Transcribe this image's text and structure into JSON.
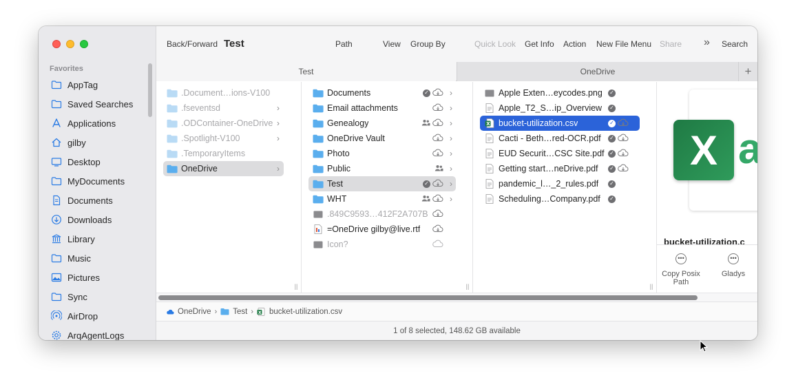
{
  "sidebar": {
    "heading": "Favorites",
    "items": [
      {
        "label": "AppTag",
        "icon": "folder-icon"
      },
      {
        "label": "Saved Searches",
        "icon": "folder-icon"
      },
      {
        "label": "Applications",
        "icon": "applications-icon"
      },
      {
        "label": "gilby",
        "icon": "home-icon"
      },
      {
        "label": "Desktop",
        "icon": "desktop-icon"
      },
      {
        "label": "MyDocuments",
        "icon": "folder-icon"
      },
      {
        "label": "Documents",
        "icon": "document-icon"
      },
      {
        "label": "Downloads",
        "icon": "download-icon"
      },
      {
        "label": "Library",
        "icon": "library-icon"
      },
      {
        "label": "Music",
        "icon": "folder-icon"
      },
      {
        "label": "Pictures",
        "icon": "pictures-icon"
      },
      {
        "label": "Sync",
        "icon": "folder-icon"
      },
      {
        "label": "AirDrop",
        "icon": "airdrop-icon"
      },
      {
        "label": "ArqAgentLogs",
        "icon": "gear-icon"
      }
    ]
  },
  "toolbar": {
    "back_forward": "Back/Forward",
    "title": "Test",
    "path": "Path",
    "view": "View",
    "group_by": "Group By",
    "quick_look": "Quick Look",
    "get_info": "Get Info",
    "action": "Action",
    "new_file_menu": "New File Menu",
    "share": "Share",
    "overflow": "»",
    "search": "Search"
  },
  "tabs": [
    {
      "label": "Test",
      "active": true
    },
    {
      "label": "OneDrive",
      "active": false
    }
  ],
  "tab_add": "+",
  "columns": {
    "col1": [
      {
        "name": ".Document…ions-V100",
        "dim": true,
        "chevron": false
      },
      {
        "name": ".fseventsd",
        "dim": true,
        "chevron": true
      },
      {
        "name": ".ODContainer-OneDrive",
        "dim": true,
        "chevron": true
      },
      {
        "name": ".Spotlight-V100",
        "dim": true,
        "chevron": true
      },
      {
        "name": ".TemporaryItems",
        "dim": true,
        "chevron": false
      },
      {
        "name": "OneDrive",
        "dim": false,
        "chevron": true,
        "selected": true
      }
    ],
    "col2": [
      {
        "name": "Documents",
        "status": "badge-cloud",
        "chevron": true
      },
      {
        "name": "Email attachments",
        "status": "cloud",
        "chevron": true
      },
      {
        "name": "Genealogy",
        "status": "people-cloud",
        "chevron": true
      },
      {
        "name": "OneDrive Vault",
        "status": "cloud",
        "chevron": true
      },
      {
        "name": "Photo",
        "status": "cloud",
        "chevron": true
      },
      {
        "name": "Public",
        "status": "people",
        "chevron": true
      },
      {
        "name": "Test",
        "status": "badge-cloud",
        "chevron": true,
        "selected": true
      },
      {
        "name": "WHT",
        "status": "people-cloud",
        "chevron": true
      },
      {
        "name": ".849C9593…412F2A707B",
        "status": "cloud",
        "dim": true,
        "chevron": false
      },
      {
        "name": "=OneDrive gilby@live.rtf",
        "status": "cloud",
        "chevron": false
      },
      {
        "name": "Icon?",
        "status": "cloud-outline",
        "dim": true,
        "chevron": false
      }
    ],
    "col3": [
      {
        "name": "Apple Exten…eycodes.png",
        "status": "badge"
      },
      {
        "name": "Apple_T2_S…ip_Overview",
        "status": "badge"
      },
      {
        "name": "bucket-utilization.csv",
        "status": "badge-cloud",
        "selected": true
      },
      {
        "name": "Cacti - Beth…red-OCR.pdf",
        "status": "badge-cloud"
      },
      {
        "name": "EUD Securit…CSC Site.pdf",
        "status": "badge-cloud"
      },
      {
        "name": "Getting start…neDrive.pdf",
        "status": "badge-cloud"
      },
      {
        "name": "pandemic_l…_2_rules.pdf",
        "status": "badge"
      },
      {
        "name": "Scheduling…Company.pdf",
        "status": "badge"
      }
    ]
  },
  "preview": {
    "letter": "X",
    "letter2": "a",
    "filename": "bucket-utilization.c",
    "actions": [
      {
        "label": "Copy Posix Path"
      },
      {
        "label": "Gladys"
      }
    ]
  },
  "pathbar": [
    "OneDrive",
    "Test",
    "bucket-utilization.csv"
  ],
  "statusbar": "1 of 8 selected, 148.62 GB available",
  "colors": {
    "accent": "#2b63d9",
    "sidebar_bg": "#e9e9ec",
    "folder": "#5aaeed",
    "excel": "#1f7a44"
  }
}
